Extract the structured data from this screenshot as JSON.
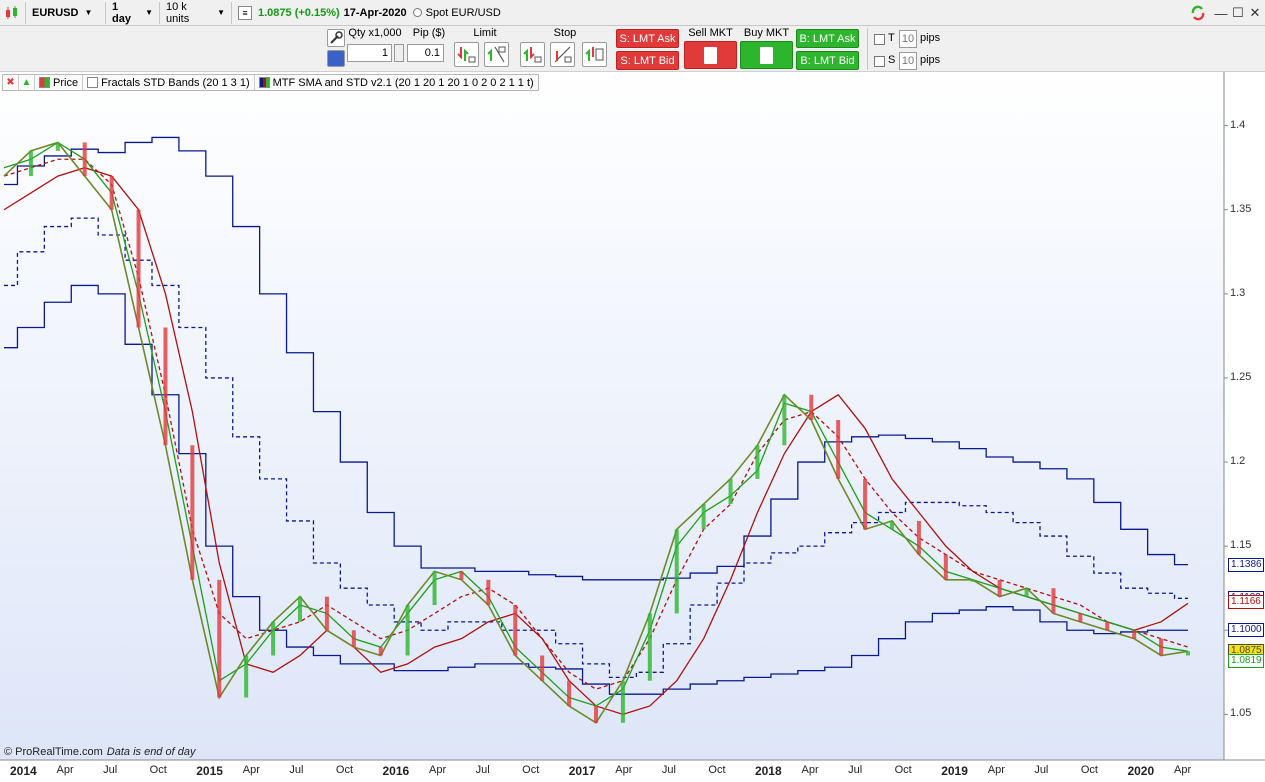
{
  "colors": {
    "accent_green": "#2db52d",
    "accent_red": "#e03a3a",
    "series_blue": "#0a1a8c",
    "series_red": "#b01010",
    "series_green": "#1aa01a",
    "chart_bg_top": "#ffffff",
    "chart_bg_bottom": "#dde6f8"
  },
  "toolbar": {
    "instrument": "EURUSD",
    "timeframe": "1 day",
    "units": "10 k units",
    "price": "1.0875 (+0.15%)",
    "date": "17-Apr-2020",
    "spot_label": "Spot EUR/USD",
    "icons": [
      "candlestick-icon",
      "sync-icon",
      "minimize-icon",
      "maximize-icon",
      "close-icon"
    ]
  },
  "order": {
    "qty_label": "Qty x1,000",
    "pip_label": "Pip ($)",
    "qty_value": "1",
    "pip_value": "0.1",
    "limit_label": "Limit",
    "stop_label": "Stop",
    "sell_mkt_label": "Sell MKT",
    "buy_mkt_label": "Buy MKT",
    "s_lmt_ask": "S: LMT Ask",
    "s_lmt_bid": "S: LMT Bid",
    "b_lmt_ask": "B: LMT Ask",
    "b_lmt_bid": "B: LMT Bid",
    "t_label": "T",
    "s_label": "S",
    "pips_value_1": "10",
    "pips_value_2": "10",
    "pips_label": "pips"
  },
  "legend": {
    "price": "Price",
    "fractals": "Fractals STD Bands (20 1 3 1)",
    "mtf": "MTF SMA and STD v2.1 (20 1 20 1 20 1 0 2 0 2 1 1 t)"
  },
  "credit": {
    "source": "© ProRealTime.com",
    "note": "Data is end of day"
  },
  "chart_data": {
    "type": "line",
    "title": "",
    "ylim": [
      1.03,
      1.42
    ],
    "y_ticks": [
      "1.4",
      "1.35",
      "1.3",
      "1.25",
      "1.2",
      "1.15",
      "1.1",
      "1.05"
    ],
    "x_ticks": [
      {
        "label": "2014",
        "year": true
      },
      {
        "label": "Apr",
        "year": false
      },
      {
        "label": "Jul",
        "year": false
      },
      {
        "label": "Oct",
        "year": false
      },
      {
        "label": "2015",
        "year": true
      },
      {
        "label": "Apr",
        "year": false
      },
      {
        "label": "Jul",
        "year": false
      },
      {
        "label": "Oct",
        "year": false
      },
      {
        "label": "2016",
        "year": true
      },
      {
        "label": "Apr",
        "year": false
      },
      {
        "label": "Jul",
        "year": false
      },
      {
        "label": "Oct",
        "year": false
      },
      {
        "label": "2017",
        "year": true
      },
      {
        "label": "Apr",
        "year": false
      },
      {
        "label": "Jul",
        "year": false
      },
      {
        "label": "Oct",
        "year": false
      },
      {
        "label": "2018",
        "year": true
      },
      {
        "label": "Apr",
        "year": false
      },
      {
        "label": "Jul",
        "year": false
      },
      {
        "label": "Oct",
        "year": false
      },
      {
        "label": "2019",
        "year": true
      },
      {
        "label": "Apr",
        "year": false
      },
      {
        "label": "Jul",
        "year": false
      },
      {
        "label": "Oct",
        "year": false
      },
      {
        "label": "2020",
        "year": true
      },
      {
        "label": "Apr",
        "year": false
      }
    ],
    "price_tags": [
      {
        "label": "1.1386",
        "value": 1.1386,
        "color": "#0a1a8c",
        "bg": "#ffffff"
      },
      {
        "label": "1.1193",
        "value": 1.1193,
        "color": "#0a1a8c",
        "bg": "#ffffff"
      },
      {
        "label": "1.1166",
        "value": 1.1166,
        "color": "#b01010",
        "bg": "#ffffff"
      },
      {
        "label": "1.1000",
        "value": 1.1,
        "color": "#0a1a8c",
        "bg": "#ffffff"
      },
      {
        "label": "1.0875",
        "value": 1.0875,
        "color": "#444444",
        "bg": "#f5e30a"
      },
      {
        "label": "1.0819",
        "value": 1.0819,
        "color": "#1aa01a",
        "bg": "#ffffff"
      }
    ],
    "series": [
      {
        "key": "blue-upper",
        "color": "#0a1a8c",
        "dash": false,
        "step": true,
        "values": [
          1.365,
          1.376,
          1.382,
          1.386,
          1.384,
          1.39,
          1.393,
          1.385,
          1.37,
          1.34,
          1.3,
          1.265,
          1.23,
          1.2,
          1.17,
          1.15,
          1.137,
          1.137,
          1.135,
          1.135,
          1.133,
          1.132,
          1.13,
          1.13,
          1.13,
          1.131,
          1.134,
          1.138,
          1.156,
          1.178,
          1.2,
          1.212,
          1.215,
          1.216,
          1.214,
          1.212,
          1.208,
          1.203,
          1.2,
          1.196,
          1.19,
          1.176,
          1.16,
          1.145,
          1.139
        ]
      },
      {
        "key": "blue-dashed",
        "color": "#0a1a8c",
        "dash": true,
        "step": true,
        "values": [
          1.305,
          1.325,
          1.34,
          1.345,
          1.335,
          1.32,
          1.305,
          1.28,
          1.25,
          1.215,
          1.19,
          1.165,
          1.14,
          1.125,
          1.115,
          1.105,
          1.1,
          1.105,
          1.105,
          1.1,
          1.1,
          1.092,
          1.08,
          1.072,
          1.075,
          1.092,
          1.115,
          1.128,
          1.14,
          1.146,
          1.15,
          1.158,
          1.164,
          1.17,
          1.176,
          1.176,
          1.174,
          1.17,
          1.164,
          1.156,
          1.144,
          1.134,
          1.125,
          1.122,
          1.119
        ]
      },
      {
        "key": "blue-lower",
        "color": "#0a1a8c",
        "dash": false,
        "step": true,
        "values": [
          1.268,
          1.28,
          1.295,
          1.305,
          1.3,
          1.27,
          1.24,
          1.205,
          1.15,
          1.12,
          1.1,
          1.09,
          1.085,
          1.08,
          1.08,
          1.076,
          1.076,
          1.078,
          1.08,
          1.08,
          1.078,
          1.077,
          1.068,
          1.062,
          1.062,
          1.065,
          1.068,
          1.07,
          1.072,
          1.074,
          1.076,
          1.078,
          1.085,
          1.095,
          1.105,
          1.11,
          1.112,
          1.114,
          1.112,
          1.105,
          1.1,
          1.098,
          1.099,
          1.1,
          1.1
        ]
      },
      {
        "key": "red-solid",
        "color": "#b01010",
        "dash": false,
        "step": false,
        "values": [
          1.35,
          1.36,
          1.37,
          1.375,
          1.37,
          1.35,
          1.3,
          1.23,
          1.14,
          1.08,
          1.075,
          1.085,
          1.1,
          1.09,
          1.075,
          1.08,
          1.09,
          1.095,
          1.105,
          1.11,
          1.095,
          1.07,
          1.055,
          1.05,
          1.055,
          1.07,
          1.095,
          1.13,
          1.17,
          1.205,
          1.23,
          1.24,
          1.22,
          1.19,
          1.17,
          1.15,
          1.135,
          1.125,
          1.12,
          1.115,
          1.11,
          1.105,
          1.1,
          1.105,
          1.116
        ]
      },
      {
        "key": "red-dashed",
        "color": "#b01010",
        "dash": true,
        "step": false,
        "values": [
          1.37,
          1.375,
          1.38,
          1.38,
          1.365,
          1.31,
          1.24,
          1.16,
          1.11,
          1.095,
          1.1,
          1.105,
          1.115,
          1.105,
          1.095,
          1.1,
          1.11,
          1.12,
          1.125,
          1.115,
          1.095,
          1.075,
          1.065,
          1.07,
          1.095,
          1.13,
          1.16,
          1.175,
          1.205,
          1.225,
          1.23,
          1.215,
          1.19,
          1.17,
          1.155,
          1.145,
          1.135,
          1.13,
          1.125,
          1.12,
          1.115,
          1.105,
          1.1,
          1.095,
          1.09
        ]
      },
      {
        "key": "green-line",
        "color": "#1aa01a",
        "dash": false,
        "step": false,
        "values": [
          1.375,
          1.38,
          1.39,
          1.38,
          1.36,
          1.3,
          1.23,
          1.15,
          1.07,
          1.08,
          1.1,
          1.115,
          1.11,
          1.095,
          1.09,
          1.11,
          1.13,
          1.135,
          1.12,
          1.09,
          1.075,
          1.06,
          1.055,
          1.065,
          1.1,
          1.15,
          1.17,
          1.18,
          1.195,
          1.235,
          1.23,
          1.2,
          1.17,
          1.16,
          1.15,
          1.135,
          1.13,
          1.125,
          1.12,
          1.115,
          1.11,
          1.105,
          1.1,
          1.09,
          1.0875
        ]
      },
      {
        "key": "price-line",
        "color": "#6d8a2a",
        "dash": false,
        "step": false,
        "values": [
          1.37,
          1.385,
          1.39,
          1.37,
          1.35,
          1.28,
          1.21,
          1.13,
          1.06,
          1.085,
          1.105,
          1.12,
          1.1,
          1.09,
          1.085,
          1.115,
          1.135,
          1.13,
          1.115,
          1.085,
          1.07,
          1.055,
          1.045,
          1.07,
          1.11,
          1.16,
          1.175,
          1.19,
          1.21,
          1.24,
          1.225,
          1.19,
          1.16,
          1.165,
          1.145,
          1.13,
          1.13,
          1.12,
          1.125,
          1.11,
          1.105,
          1.1,
          1.095,
          1.085,
          1.0875
        ]
      }
    ]
  }
}
